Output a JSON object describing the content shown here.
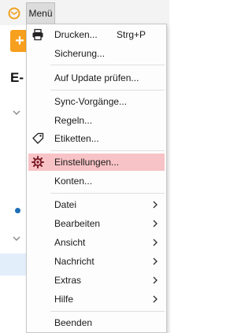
{
  "menubar": {
    "menu_label": "Menü"
  },
  "app": {
    "compose_symbol": "+",
    "section_title_fragment": "E-"
  },
  "menu": {
    "print": {
      "label": "Drucken...",
      "shortcut": "Strg+P"
    },
    "backup": {
      "label": "Sicherung..."
    },
    "check_update": {
      "label": "Auf Update prüfen..."
    },
    "sync": {
      "label": "Sync-Vorgänge..."
    },
    "rules": {
      "label": "Regeln..."
    },
    "tags": {
      "label": "Etiketten..."
    },
    "settings": {
      "label": "Einstellungen..."
    },
    "accounts": {
      "label": "Konten..."
    },
    "file": {
      "label": "Datei"
    },
    "edit": {
      "label": "Bearbeiten"
    },
    "view": {
      "label": "Ansicht"
    },
    "message": {
      "label": "Nachricht"
    },
    "extras": {
      "label": "Extras"
    },
    "help": {
      "label": "Hilfe"
    },
    "quit": {
      "label": "Beenden"
    }
  },
  "colors": {
    "highlight": "#f8c3c6",
    "settings_icon": "#7a1a24",
    "accent_orange": "#f79f1e"
  },
  "icons": {
    "app_logo": "mail-app-logo-icon",
    "print": "printer-icon",
    "tags": "tag-icon",
    "settings": "gear-icon",
    "submenu": "chevron-right-icon"
  }
}
